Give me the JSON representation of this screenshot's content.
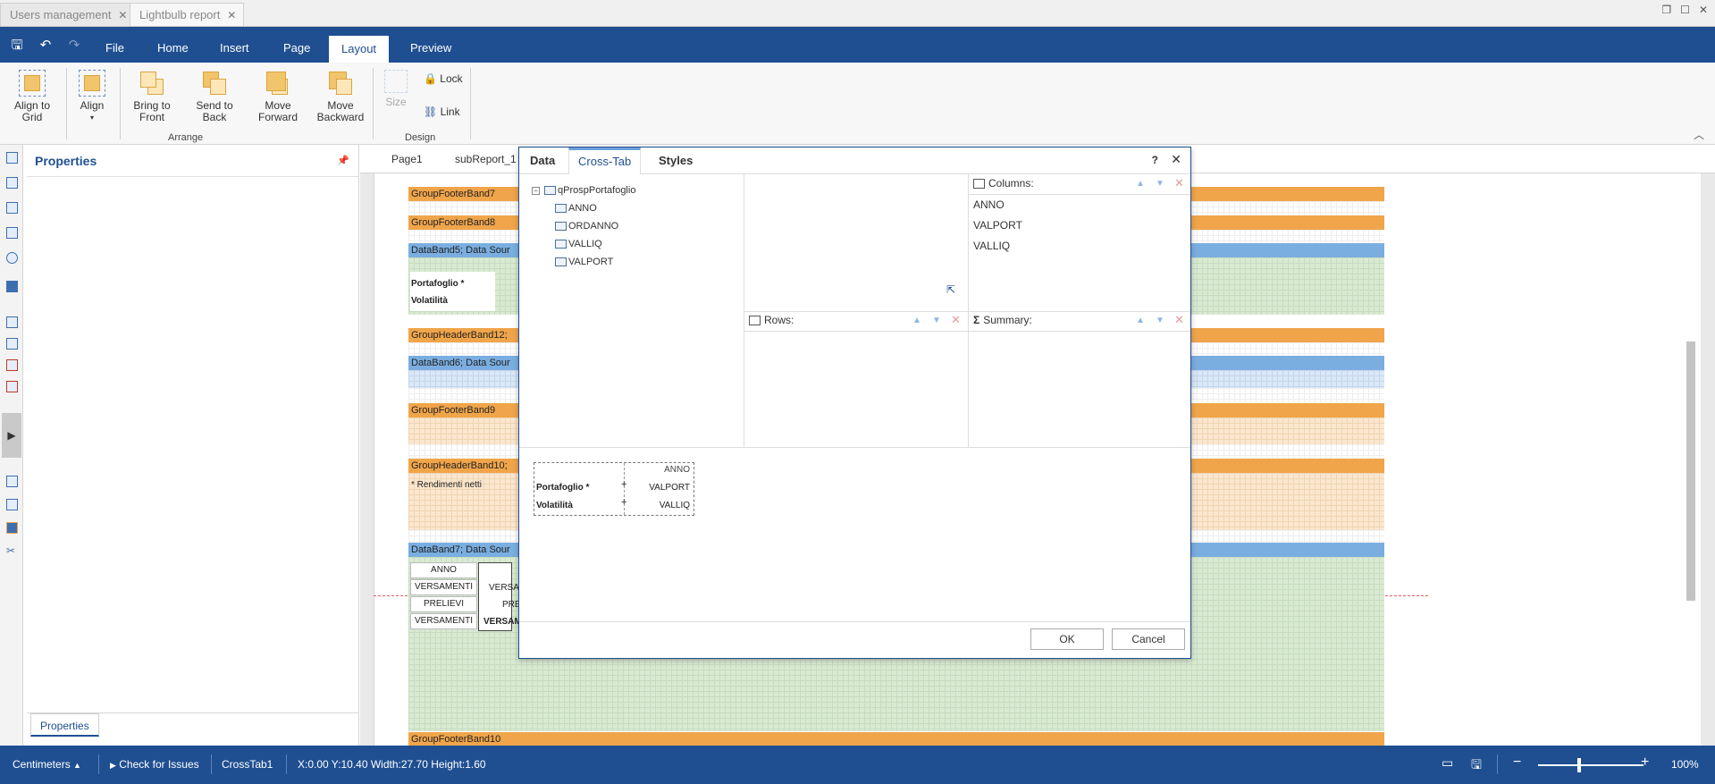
{
  "browser_tabs": [
    {
      "label": "Users management"
    },
    {
      "label": "Lightbulb report"
    }
  ],
  "ribbon_tabs": [
    "File",
    "Home",
    "Insert",
    "Page",
    "Layout",
    "Preview"
  ],
  "ribbon_active_tab": "Layout",
  "ribbon": {
    "align_to_grid": "Align to Grid",
    "align": "Align",
    "bring_to_front": "Bring to Front",
    "send_to_back": "Send to Back",
    "move_forward": "Move Forward",
    "move_backward": "Move Backward",
    "arrange_group": "Arrange",
    "size": "Size",
    "lock": "Lock",
    "link": "Link",
    "design_group": "Design"
  },
  "properties_panel": {
    "title": "Properties",
    "footer_tab": "Properties"
  },
  "doc_tabs": [
    "Page1",
    "subReport_1"
  ],
  "bands": {
    "gfb7": "GroupFooterBand7",
    "gfb8": "GroupFooterBand8",
    "db5": "DataBand5; Data Sour",
    "ghb12": "GroupHeaderBand12;",
    "db6": "DataBand6; Data Sour",
    "gfb9": "GroupFooterBand9",
    "ghb10": "GroupHeaderBand10;",
    "rendimenti": "Rendimenti netti",
    "db7": "DataBand7; Data Sour",
    "gfb10": "GroupFooterBand10",
    "portafoglio": "Portafoglio *",
    "volatilita": "Volatilità",
    "anno": "ANNO",
    "versamenti": "VERSAMENTI",
    "prelievi": "PRELIEVI",
    "versamenti2": "VERSAMENTI",
    "versa_short": "VERSA",
    "prel_short": "PRE",
    "versam_short": "VERSAM"
  },
  "dialog": {
    "tabs": [
      "Data",
      "Cross-Tab",
      "Styles"
    ],
    "active_tab": "Cross-Tab",
    "help": "?",
    "datasource": "qProspPortafoglio",
    "fields": [
      "ANNO",
      "ORDANNO",
      "VALLIQ",
      "VALPORT"
    ],
    "columns_label": "Columns:",
    "columns": [
      "ANNO",
      "VALPORT",
      "VALLIQ"
    ],
    "rows_label": "Rows:",
    "summary_label": "Summary:",
    "preview": {
      "anno": "ANNO",
      "portafoglio": "Portafoglio *",
      "valport": "VALPORT",
      "volatilita": "Volatilità",
      "valliq": "VALLIQ"
    },
    "ok": "OK",
    "cancel": "Cancel"
  },
  "status": {
    "units": "Centimeters",
    "check": "Check for Issues",
    "component": "CrossTab1",
    "coords": "X:0.00 Y:10.40 Width:27.70 Height:1.60",
    "zoom": "100%"
  },
  "colors": {
    "ribbon_blue": "#1f4f91",
    "band_orange": "#f0a54a",
    "band_blue": "#7aaee0",
    "band_green": "#d9ead3"
  }
}
